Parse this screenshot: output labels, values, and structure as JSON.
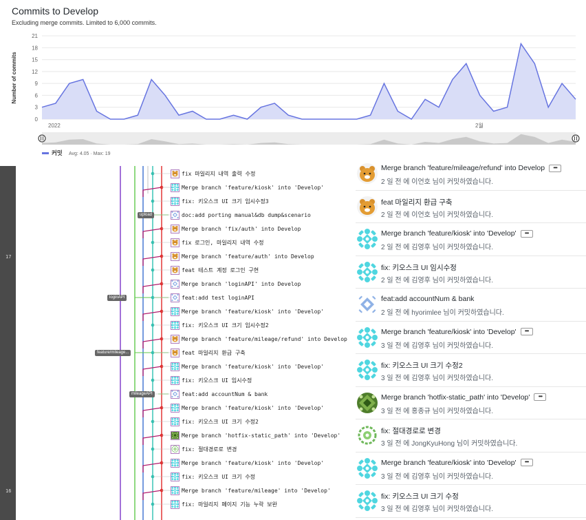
{
  "chart": {
    "title": "Commits to Develop",
    "subtitle": "Excluding merge commits. Limited to 6,000 commits.",
    "y_axis_label": "Number of commits",
    "x_ticks": [
      "2022",
      "2월"
    ],
    "legend_label": "커밋",
    "legend_stats": "Avg: 4.05 · Max: 19",
    "series_color": "#6674e0",
    "fill_color": "#d9ddf7"
  },
  "chart_data": {
    "type": "area",
    "title": "Commits to Develop",
    "ylabel": "Number of commits",
    "ylim": [
      0,
      21
    ],
    "yticks": [
      0,
      3,
      6,
      9,
      12,
      15,
      18,
      21
    ],
    "grid": true,
    "series": [
      {
        "name": "커밋",
        "values": [
          3,
          4,
          9,
          10,
          2,
          0,
          0,
          1,
          10,
          6,
          1,
          2,
          0,
          0,
          1,
          0,
          3,
          4,
          1,
          0,
          0,
          0,
          0,
          0,
          1,
          9,
          2,
          0,
          5,
          3,
          10,
          14,
          6,
          2,
          3,
          19,
          14,
          3,
          9,
          5
        ]
      }
    ]
  },
  "graph": {
    "gutter_labels": [
      "17",
      "16"
    ],
    "branch_tags": [
      "upload",
      "loginAPI",
      "feature/mileage...",
      "mileageAPI"
    ],
    "rows": [
      {
        "msg": "fix 마일리지 내역 출력 수정",
        "avatar": "ryan"
      },
      {
        "msg": "Merge branch 'feature/kiosk' into 'Develop'",
        "avatar": "cyan-flower"
      },
      {
        "msg": "fix: 키오스크 UI 크기 임시수정3",
        "avatar": "cyan-flower"
      },
      {
        "msg": "doc:add porting manual&db dump&scenario",
        "avatar": "blue-pattern"
      },
      {
        "msg": "Merge branch 'fix/auth' into Develop",
        "avatar": "ryan"
      },
      {
        "msg": "fix 로그인, 마일리지 내역 수정",
        "avatar": "ryan"
      },
      {
        "msg": "Merge branch 'feature/auth' into Develop",
        "avatar": "ryan"
      },
      {
        "msg": "feat 테스트 계정 로그인 구현",
        "avatar": "ryan"
      },
      {
        "msg": "Merge branch 'loginAPI' into Develop",
        "avatar": "blue-pattern"
      },
      {
        "msg": "feat:add test loginAPI",
        "avatar": "blue-pattern"
      },
      {
        "msg": "Merge branch 'feature/kiosk' into 'Develop'",
        "avatar": "cyan-flower"
      },
      {
        "msg": "fix: 키오스크 UI 크기 임시수정2",
        "avatar": "cyan-flower"
      },
      {
        "msg": "Merge branch 'feature/mileage/refund' into Develop",
        "avatar": "ryan"
      },
      {
        "msg": "feat 마일리지 환급 구축",
        "avatar": "ryan"
      },
      {
        "msg": "Merge branch 'feature/kiosk' into 'Develop'",
        "avatar": "cyan-flower"
      },
      {
        "msg": "fix: 키오스크 UI 임시수정",
        "avatar": "cyan-flower"
      },
      {
        "msg": "feat:add accountNum & bank",
        "avatar": "blue-pattern"
      },
      {
        "msg": "Merge branch 'feature/kiosk' into 'Develop'",
        "avatar": "cyan-flower"
      },
      {
        "msg": "fix: 키오스크 UI 크기 수정2",
        "avatar": "cyan-flower"
      },
      {
        "msg": "Merge branch 'hotfix-static_path' into 'Develop'",
        "avatar": "green-pattern"
      },
      {
        "msg": "fix: 절대경로로 변경",
        "avatar": "green-ring"
      },
      {
        "msg": "Merge branch 'feature/kiosk' into 'Develop'",
        "avatar": "cyan-flower"
      },
      {
        "msg": "fix: 키오스크 UI 크기 수정",
        "avatar": "cyan-flower"
      },
      {
        "msg": "Merge branch 'feature/mileage' into 'Develop'",
        "avatar": "cyan-flower"
      },
      {
        "msg": "fix: 마일리지 페이지 기능 누락 보완",
        "avatar": "cyan-flower"
      }
    ]
  },
  "commits": [
    {
      "title": "Merge branch 'feature/mileage/refund' into Develop",
      "ago": "2 일 전 에",
      "author": "이언호",
      "suffix": "님이 커밋하였습니다.",
      "more": true,
      "avatar": "ryan"
    },
    {
      "title": "feat 마일리지 환급 구축",
      "ago": "2 일 전 에",
      "author": "이언호",
      "suffix": "님이 커밋하였습니다.",
      "more": false,
      "avatar": "ryan"
    },
    {
      "title": "Merge branch 'feature/kiosk' into 'Develop'",
      "ago": "2 일 전 에",
      "author": "김영후",
      "suffix": "님이 커밋하였습니다.",
      "more": true,
      "avatar": "cyan-flower"
    },
    {
      "title": "fix: 키오스크 UI 임시수정",
      "ago": "2 일 전 에",
      "author": "김영후",
      "suffix": "님이 커밋하였습니다.",
      "more": false,
      "avatar": "cyan-flower"
    },
    {
      "title": "feat:add accountNum & bank",
      "ago": "2 일 전 에",
      "author": "hyorimlee",
      "suffix": "님이 커밋하였습니다.",
      "more": false,
      "avatar": "blue-pattern"
    },
    {
      "title": "Merge branch 'feature/kiosk' into 'Develop'",
      "ago": "3 일 전 에",
      "author": "김영후",
      "suffix": "님이 커밋하였습니다.",
      "more": true,
      "avatar": "cyan-flower"
    },
    {
      "title": "fix: 키오스크 UI 크기 수정2",
      "ago": "3 일 전 에",
      "author": "김영후",
      "suffix": "님이 커밋하였습니다.",
      "more": false,
      "avatar": "cyan-flower"
    },
    {
      "title": "Merge branch 'hotfix-static_path' into 'Develop'",
      "ago": "3 일 전 에",
      "author": "홍종규",
      "suffix": "님이 커밋하였습니다.",
      "more": true,
      "avatar": "green-pattern"
    },
    {
      "title": "fix: 절대경로로 변경",
      "ago": "3 일 전 에",
      "author": "JongKyuHong",
      "suffix": "님이 커밋하였습니다.",
      "more": false,
      "avatar": "green-ring"
    },
    {
      "title": "Merge branch 'feature/kiosk' into 'Develop'",
      "ago": "3 일 전 에",
      "author": "김영후",
      "suffix": "님이 커밋하였습니다.",
      "more": true,
      "avatar": "cyan-flower"
    },
    {
      "title": "fix: 키오스크 UI 크기 수정",
      "ago": "3 일 전 에",
      "author": "김영후",
      "suffix": "님이 커밋하였습니다.",
      "more": false,
      "avatar": "cyan-flower"
    }
  ],
  "more_label": "•••"
}
